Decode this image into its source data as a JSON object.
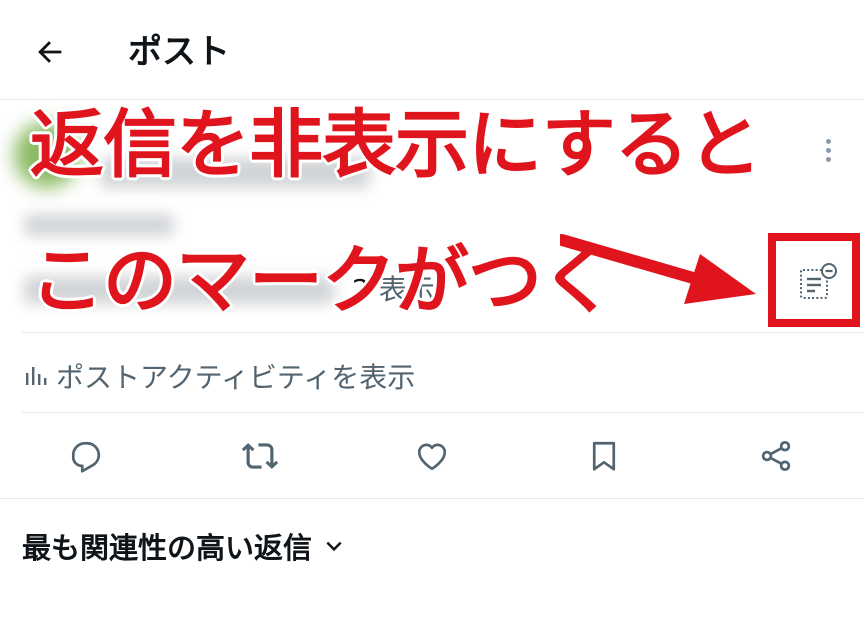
{
  "header": {
    "title": "ポスト",
    "back_icon": "arrow-left-icon"
  },
  "post": {
    "views_count": "2",
    "views_label": "表示"
  },
  "activity": {
    "label": "ポストアクティビティを表示",
    "icon": "bar-chart-icon"
  },
  "actions": [
    {
      "icon": "reply-icon"
    },
    {
      "icon": "repost-icon"
    },
    {
      "icon": "like-icon"
    },
    {
      "icon": "bookmark-icon"
    },
    {
      "icon": "share-icon"
    }
  ],
  "replies": {
    "sort_label": "最も関連性の高い返信"
  },
  "annotation": {
    "line1": "返信を非表示にすると",
    "line2": "このマークがつく",
    "color": "#e0141c"
  },
  "colors": {
    "text": "#0f1419",
    "secondary": "#536471",
    "divider": "#e6e9ec",
    "annotation": "#e0141c"
  }
}
